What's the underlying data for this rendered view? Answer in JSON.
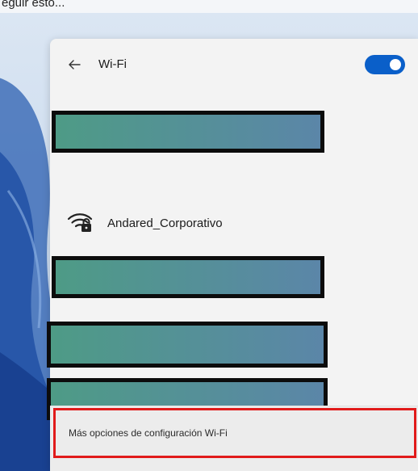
{
  "caption": "eguir esto...",
  "header": {
    "back_icon": "arrow-left-icon",
    "title": "Wi-Fi",
    "wifi_toggle": {
      "state": "on",
      "accent": "#0a5fc9"
    }
  },
  "networks": {
    "visible_network": {
      "name": "Andared_Corporativo",
      "icon": "wifi-secured-icon"
    },
    "redacted_count": 4,
    "redaction_fill": "#4e9b86",
    "redaction_border": "#0c0c0c"
  },
  "footer": {
    "more_settings_label": "Más opciones de configuración Wi-Fi",
    "highlight_color": "#e11b1b"
  }
}
